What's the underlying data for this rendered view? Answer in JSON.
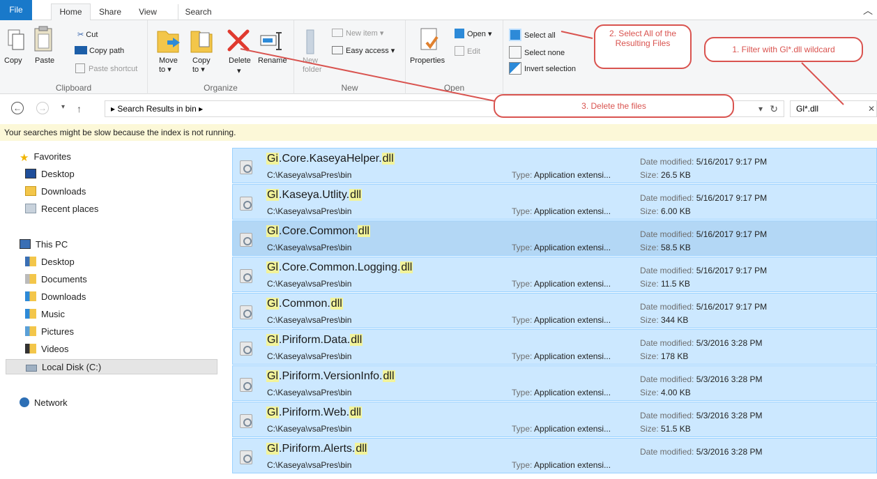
{
  "tabs": {
    "file": "File",
    "home": "Home",
    "share": "Share",
    "view": "View",
    "search": "Search"
  },
  "ribbon": {
    "clipboard": {
      "label": "Clipboard",
      "copy": "Copy",
      "paste": "Paste",
      "cut": "Cut",
      "copy_path": "Copy path",
      "paste_shortcut": "Paste shortcut"
    },
    "organize": {
      "label": "Organize",
      "move_to": "Move to ▾",
      "copy_to": "Copy to ▾",
      "delete": "Delete",
      "delete_arrow": "▾",
      "rename": "Rename"
    },
    "new": {
      "label": "New",
      "new_folder": "New folder",
      "new_item": "New item ▾",
      "easy_access": "Easy access ▾"
    },
    "open": {
      "label": "Open",
      "properties": "Properties",
      "open": "Open ▾",
      "edit": "Edit"
    },
    "select": {
      "select_all": "Select all",
      "select_none": "Select none",
      "invert_selection": "Invert selection"
    }
  },
  "address": {
    "path": "▸  Search Results in bin  ▸",
    "search_value": "Gl*.dll",
    "back": "←",
    "forward": "→",
    "recent": "▾",
    "up": "↑",
    "refresh": "↻",
    "dropdown": "▾",
    "clear": "✕"
  },
  "infobar": "Your searches might be slow because the index is not running.",
  "nav": {
    "favorites": "Favorites",
    "desktop": "Desktop",
    "downloads": "Downloads",
    "recent": "Recent places",
    "thispc": "This PC",
    "pc_desktop": "Desktop",
    "documents": "Documents",
    "pc_downloads": "Downloads",
    "music": "Music",
    "pictures": "Pictures",
    "videos": "Videos",
    "localdisk": "Local Disk (C:)",
    "network": "Network"
  },
  "labels": {
    "date": "Date modified: ",
    "size": "Size: ",
    "type": "Type: "
  },
  "files": [
    {
      "pre": "Gi",
      "mid": ".Core.KaseyaHelper.",
      "ext": "dll",
      "path": "C:\\Kaseya\\vsaPres\\bin",
      "type": "Application extensi...",
      "date": "5/16/2017 9:17 PM",
      "size": "26.5 KB"
    },
    {
      "pre": "Gl",
      "mid": ".Kaseya.Utlity.",
      "ext": "dll",
      "path": "C:\\Kaseya\\vsaPres\\bin",
      "type": "Application extensi...",
      "date": "5/16/2017 9:17 PM",
      "size": "6.00 KB"
    },
    {
      "pre": "Gl",
      "mid": ".Core.Common.",
      "ext": "dll",
      "path": "C:\\Kaseya\\vsaPres\\bin",
      "type": "Application extensi...",
      "date": "5/16/2017 9:17 PM",
      "size": "58.5 KB"
    },
    {
      "pre": "Gl",
      "mid": ".Core.Common.Logging.",
      "ext": "dll",
      "path": "C:\\Kaseya\\vsaPres\\bin",
      "type": "Application extensi...",
      "date": "5/16/2017 9:17 PM",
      "size": "11.5 KB"
    },
    {
      "pre": "Gl",
      "mid": ".Common.",
      "ext": "dll",
      "path": "C:\\Kaseya\\vsaPres\\bin",
      "type": "Application extensi...",
      "date": "5/16/2017 9:17 PM",
      "size": "344 KB"
    },
    {
      "pre": "Gl",
      "mid": ".Piriform.Data.",
      "ext": "dll",
      "path": "C:\\Kaseya\\vsaPres\\bin",
      "type": "Application extensi...",
      "date": "5/3/2016 3:28 PM",
      "size": "178 KB"
    },
    {
      "pre": "Gl",
      "mid": ".Piriform.VersionInfo.",
      "ext": "dll",
      "path": "C:\\Kaseya\\vsaPres\\bin",
      "type": "Application extensi...",
      "date": "5/3/2016 3:28 PM",
      "size": "4.00 KB"
    },
    {
      "pre": "Gl",
      "mid": ".Piriform.Web.",
      "ext": "dll",
      "path": "C:\\Kaseya\\vsaPres\\bin",
      "type": "Application extensi...",
      "date": "5/3/2016 3:28 PM",
      "size": "51.5 KB"
    },
    {
      "pre": "Gl",
      "mid": ".Piriform.Alerts.",
      "ext": "dll",
      "path": "C:\\Kaseya\\vsaPres\\bin",
      "type": "Application extensi...",
      "date": "5/3/2016 3:28 PM",
      "size": ""
    }
  ],
  "callouts": {
    "c1": "1. Filter with Gl*.dll wildcard",
    "c2": "2. Select All of the Resulting Files",
    "c3": "3. Delete the files"
  },
  "colors": {
    "accent": "#1979ca",
    "selection": "#cce8ff",
    "callout": "#d9534f",
    "highlight": "#f2f39a"
  }
}
